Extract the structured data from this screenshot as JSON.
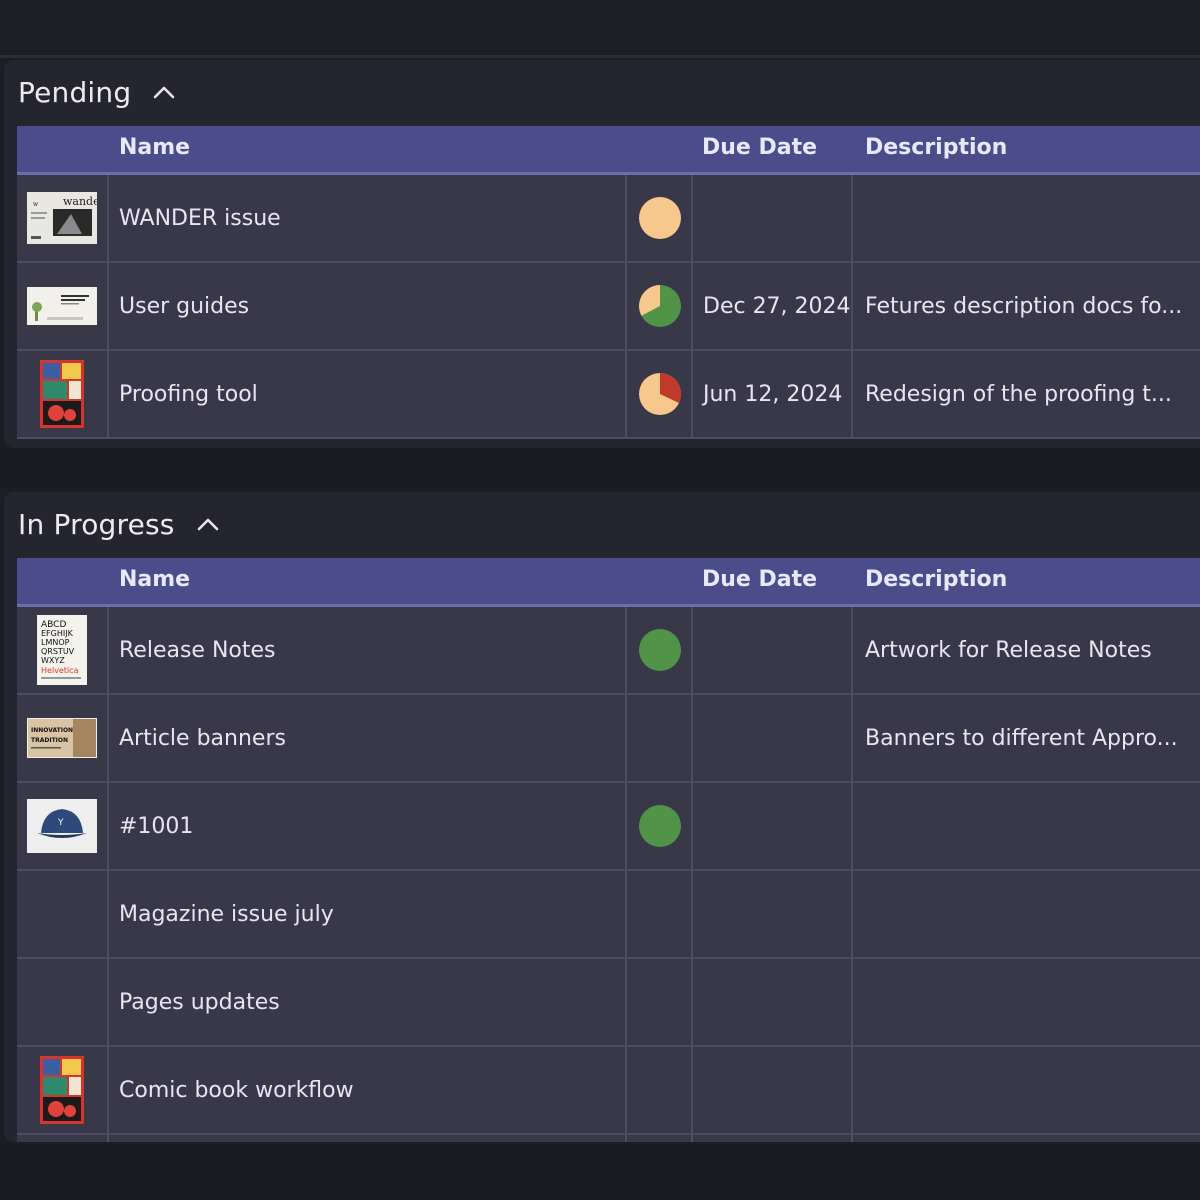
{
  "colors": {
    "header_bg": "#4a4d8a",
    "row_bg": "#393848",
    "status_pending": "#f6c88b",
    "status_done": "#519447",
    "status_late": "#c0392b"
  },
  "sections": [
    {
      "title": "Pending",
      "columns": {
        "name": "Name",
        "due": "Due Date",
        "description": "Description"
      },
      "rows": [
        {
          "thumb": "wander-magazine-cover",
          "thumb_text": "wander",
          "name": "WANDER issue",
          "status": "pending",
          "due": "",
          "description": ""
        },
        {
          "thumb": "user-guide-cover",
          "thumb_text": "HOW TO SET UP A WORKFLOW",
          "name": "User guides",
          "status": "partial-green",
          "due": "Dec 27, 2024",
          "description": "Fetures description docs fo..."
        },
        {
          "thumb": "comic-cover",
          "thumb_text": "",
          "name": "Proofing tool",
          "status": "partial-red",
          "due": "Jun 12, 2024",
          "description": "Redesign of the proofing t..."
        }
      ]
    },
    {
      "title": "In Progress",
      "columns": {
        "name": "Name",
        "due": "Due Date",
        "description": "Description"
      },
      "rows": [
        {
          "thumb": "helvetica-poster",
          "thumb_text": "ABCD EFGHIJK LMNOP QRSTUV WXYZ Helvetica",
          "name": "Release Notes",
          "status": "done",
          "due": "",
          "description": "Artwork for Release Notes"
        },
        {
          "thumb": "innovation-banner",
          "thumb_text": "INNOVATION TRADITION",
          "name": "Article banners",
          "status": "",
          "due": "",
          "description": "Banners to different Appro..."
        },
        {
          "thumb": "cap-photo",
          "thumb_text": "",
          "name": "#1001",
          "status": "done",
          "due": "",
          "description": ""
        },
        {
          "thumb": "",
          "thumb_text": "",
          "name": "Magazine issue july",
          "status": "",
          "due": "",
          "description": ""
        },
        {
          "thumb": "",
          "thumb_text": "",
          "name": "Pages updates",
          "status": "",
          "due": "",
          "description": ""
        },
        {
          "thumb": "comic-cover",
          "thumb_text": "",
          "name": "Comic book workflow",
          "status": "",
          "due": "",
          "description": ""
        }
      ]
    }
  ]
}
